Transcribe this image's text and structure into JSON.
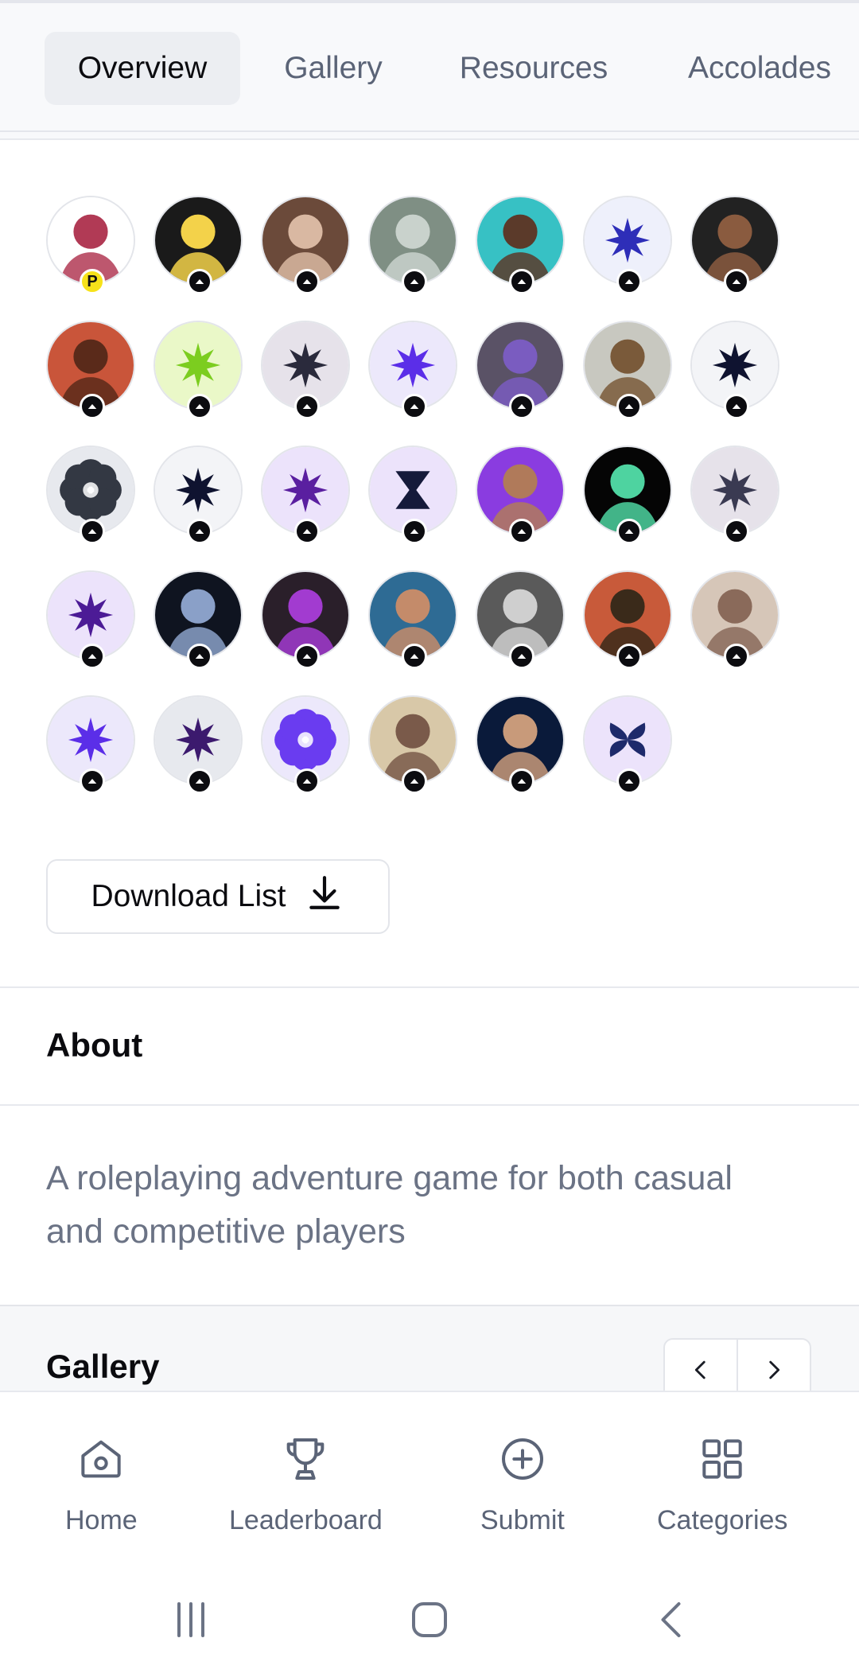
{
  "tabs": [
    {
      "label": "Overview",
      "active": true
    },
    {
      "label": "Gallery",
      "active": false
    },
    {
      "label": "Resources",
      "active": false
    },
    {
      "label": "Accolades",
      "active": false
    }
  ],
  "upvoters": {
    "avatars": [
      "photo-user",
      "photo-user",
      "photo-user",
      "photo-user",
      "photo-user",
      "star-icon",
      "photo-user",
      "photo-user",
      "star-icon",
      "star-icon",
      "star-icon",
      "photo-user",
      "photo-user",
      "star-icon",
      "flower-icon",
      "star-icon",
      "star-icon",
      "hourglass-icon",
      "photo-user",
      "photo-user",
      "star-icon",
      "star-icon",
      "photo-user",
      "photo-user",
      "photo-user",
      "photo-user",
      "photo-user",
      "photo-user",
      "star-icon",
      "star-icon",
      "flower-icon",
      "photo-user",
      "photo-user",
      "bowtie-icon"
    ],
    "premium_badge": "P",
    "download_label": "Download List"
  },
  "about": {
    "title": "About",
    "text": "A roleplaying adventure game for both casual and competitive players"
  },
  "gallery": {
    "title": "Gallery"
  },
  "bottom_nav": [
    {
      "label": "Home",
      "icon": "home-icon"
    },
    {
      "label": "Leaderboard",
      "icon": "trophy-icon"
    },
    {
      "label": "Submit",
      "icon": "plus-circle-icon"
    },
    {
      "label": "Categories",
      "icon": "grid-icon"
    }
  ],
  "colors": {
    "accent_purple": "#5b2ee8",
    "muted_text": "#5b6477",
    "badge_yellow": "#f7e21a"
  }
}
